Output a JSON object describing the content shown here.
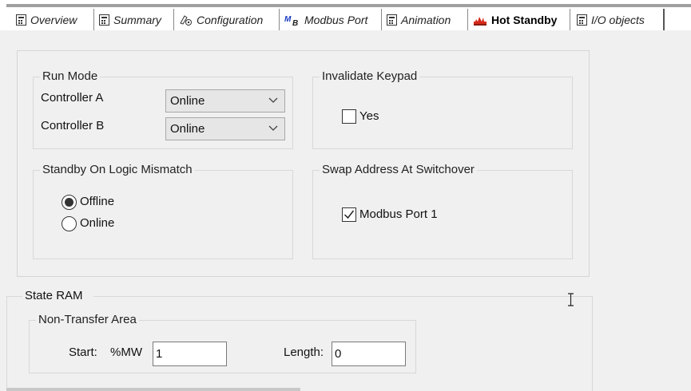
{
  "tabs": [
    {
      "label": "Overview",
      "icon": "module-icon"
    },
    {
      "label": "Summary",
      "icon": "module-icon"
    },
    {
      "label": "Configuration",
      "icon": "configuration-icon"
    },
    {
      "label": "Modbus Port",
      "icon": "modbus-icon"
    },
    {
      "label": "Animation",
      "icon": "module-icon"
    },
    {
      "label": "Hot Standby",
      "icon": "hot-standby-icon",
      "active": true
    },
    {
      "label": "I/O objects",
      "icon": "module-icon"
    }
  ],
  "run_mode": {
    "title": "Run Mode",
    "controller_a_label": "Controller A",
    "controller_a_value": "Online",
    "controller_b_label": "Controller B",
    "controller_b_value": "Online"
  },
  "invalidate_keypad": {
    "title": "Invalidate Keypad",
    "option_label": "Yes",
    "checked": false
  },
  "standby_on_logic_mismatch": {
    "title": "Standby On Logic Mismatch",
    "options": [
      {
        "label": "Offline",
        "selected": true
      },
      {
        "label": "Online",
        "selected": false
      }
    ]
  },
  "swap_address": {
    "title": "Swap Address At Switchover",
    "option_label": "Modbus Port 1",
    "checked": true
  },
  "state_ram": {
    "title": "State RAM",
    "non_transfer_area": {
      "title": "Non-Transfer Area",
      "start_label": "Start:",
      "start_prefix": "%MW",
      "start_value": "1",
      "length_label": "Length:",
      "length_value": "0"
    }
  },
  "colors": {
    "accent_red": "#d42a1a",
    "modbus_blue": "#1a3cc4"
  }
}
